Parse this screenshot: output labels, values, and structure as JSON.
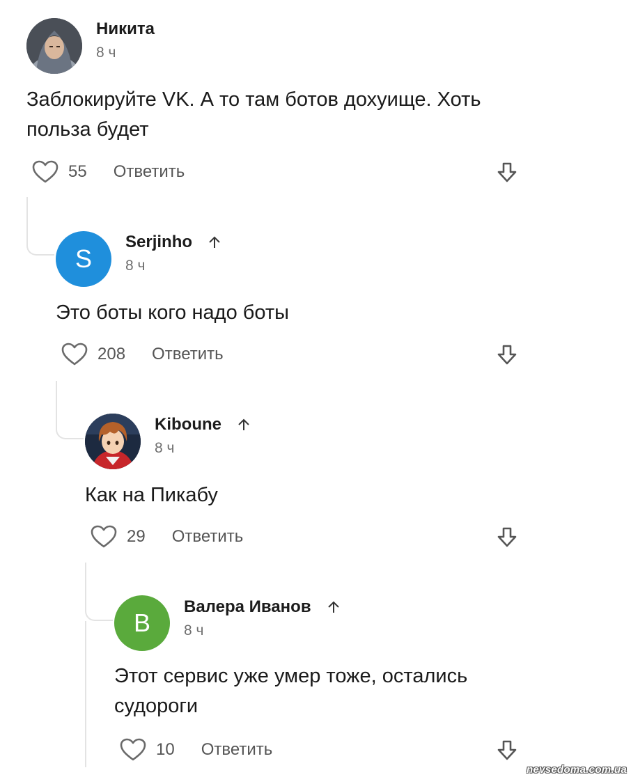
{
  "comments": [
    {
      "author": "Никита",
      "time": "8 ч",
      "text": "Заблокируйте VK. А то там ботов дохуище. Хоть польза будет",
      "likes": "55",
      "reply_label": "Ответить",
      "avatar_icon": "user-photo-icon"
    },
    {
      "author": "Serjinho",
      "time": "8 ч",
      "text": "Это боты кого надо боты",
      "likes": "208",
      "reply_label": "Ответить",
      "avatar_letter": "S",
      "avatar_color": "#1f8fdc"
    },
    {
      "author": "Kiboune",
      "time": "8 ч",
      "text": "Как на Пикабу",
      "likes": "29",
      "reply_label": "Ответить",
      "avatar_icon": "anime-avatar-icon"
    },
    {
      "author": "Валера Иванов",
      "time": "8 ч",
      "text": "Этот сервис уже умер тоже, остались судороги",
      "likes": "10",
      "reply_label": "Ответить",
      "avatar_letter": "B",
      "avatar_color": "#5aaa3c"
    }
  ],
  "watermark": "nevsedoma.com.ua"
}
